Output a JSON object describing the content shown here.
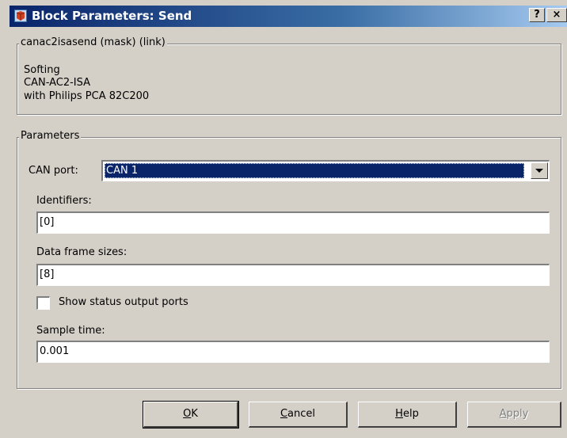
{
  "window": {
    "title": "Block Parameters: Send",
    "help_button": "?",
    "close_button": "×"
  },
  "description": {
    "group_title": "canac2isasend (mask) (link)",
    "lines": [
      "Softing",
      "CAN-AC2-ISA",
      "with Philips PCA 82C200"
    ]
  },
  "parameters": {
    "group_title": "Parameters",
    "can_port_label": "CAN port:",
    "can_port_value": "CAN 1",
    "identifiers_label": "Identifiers:",
    "identifiers_value": "[0]",
    "data_frame_label": "Data frame sizes:",
    "data_frame_value": "[8]",
    "show_status_label": "Show status output ports",
    "show_status_checked": false,
    "sample_time_label": "Sample time:",
    "sample_time_value": "0.001"
  },
  "buttons": {
    "ok_label": "OK",
    "cancel_label": "Cancel",
    "help_label": "Help",
    "apply_label": "Apply"
  },
  "colors": {
    "title_bar_start": "#0a246a",
    "title_bar_end": "#a6caf0",
    "dialog_face": "#d4d0c8",
    "selection": "#0a246a"
  },
  "icons": [
    "simulink-block-icon",
    "help-icon",
    "close-icon",
    "dropdown-arrow-icon"
  ]
}
